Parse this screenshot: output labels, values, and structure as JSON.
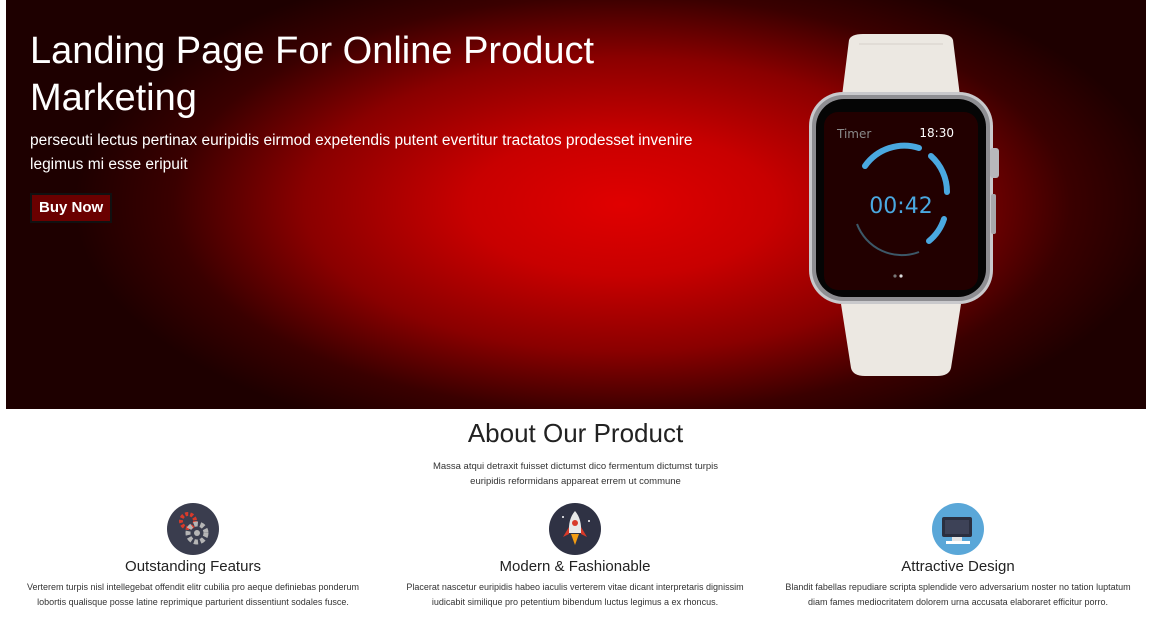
{
  "hero": {
    "title": "Landing Page For Online Product Marketing",
    "subtitle": "persecuti lectus pertinax euripidis eirmod expetendis putent evertitur tractatos prodesset invenire legimus mi esse eripuit",
    "buy_label": "Buy Now",
    "image": "smartwatch-image",
    "watch": {
      "label": "Timer",
      "time": "18:30",
      "timer": "00:42"
    }
  },
  "about": {
    "title": "About Our Product",
    "description": "Massa atqui detraxit fuisset dictumst dico fermentum dictumst turpis euripidis reformidans appareat errem ut commune"
  },
  "features": [
    {
      "icon": "gears-icon",
      "title": "Outstanding Featurs",
      "text": "Verterem turpis nisl intellegebat offendit elitr cubilia pro aeque definiebas ponderum lobortis qualisque posse latine reprimique parturient dissentiunt sodales fusce."
    },
    {
      "icon": "rocket-icon",
      "title": "Modern & Fashionable",
      "text": "Placerat nascetur euripidis habeo iaculis verterem vitae dicant interpretaris dignissim iudicabit similique pro petentium bibendum luctus legimus a ex rhoncus."
    },
    {
      "icon": "monitor-icon",
      "title": "Attractive Design",
      "text": "Blandit fabellas repudiare scripta splendide vero adversarium noster no tation luptatum diam fames mediocritatem dolorem urna accusata elaboraret efficitur porro."
    }
  ],
  "colors": {
    "hero_red": "#d40000",
    "hero_dark": "#1e0000",
    "timer_blue": "#4aa8e0"
  }
}
